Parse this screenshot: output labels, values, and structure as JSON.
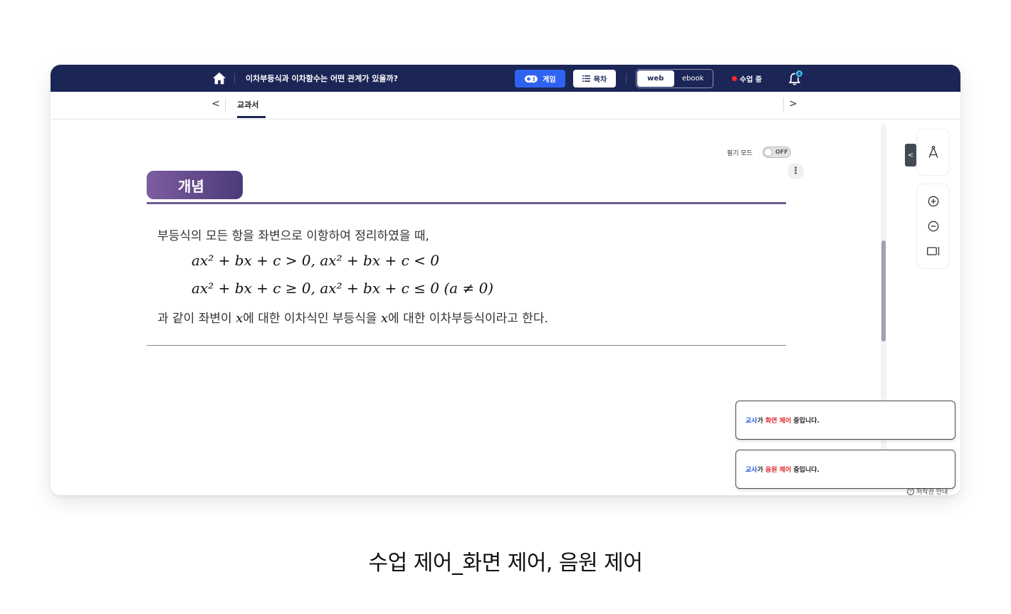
{
  "topbar": {
    "lesson_title": "이차부등식과 이차함수는 어떤 관계가 있을까?",
    "game_label": "게임",
    "toc_label": "목차",
    "view_web": "web",
    "view_ebook": "ebook",
    "live_status": "수업 중",
    "notification_count": "4",
    "colors": {
      "bar": "#1c2656",
      "game": "#2e63f1",
      "live": "#ff2a2a"
    }
  },
  "tabs": {
    "prev": "<",
    "next": ">",
    "items": [
      {
        "label": "교과서",
        "active": true
      }
    ]
  },
  "content": {
    "writing_mode_label": "필기 모드",
    "writing_mode_state": "OFF",
    "more_label": "⋮",
    "concept_badge": "개념",
    "line1": "부등식의 모든 항을 좌변으로 이항하여 정리하였을 때,",
    "math_line2": "ax² + bx + c > 0,    ax² + bx + c < 0",
    "math_line3": "ax² + bx + c ≥ 0,    ax² + bx + c ≤ 0 (a ≠ 0)",
    "line4_part1": "과 같이 좌변이 ",
    "line4_var1": "x",
    "line4_part2": "에 대한 이차식인 부등식을 ",
    "line4_var2": "x",
    "line4_part3": "에 대한 이차부등식이라고 한다."
  },
  "tools": {
    "collapse": "<",
    "icons": [
      "compass-icon",
      "zoom-in-icon",
      "zoom-out-icon",
      "fit-screen-icon"
    ]
  },
  "toasts": [
    {
      "who": "교사",
      "particle1": "가 ",
      "what": "화면 제어",
      "rest": " 중입니다."
    },
    {
      "who": "교사",
      "particle1": "가 ",
      "what": "음원 제어",
      "rest": " 중입니다."
    }
  ],
  "copyright": {
    "icon": "?",
    "label": "저작권 안내"
  },
  "caption": "수업 제어_화면 제어, 음원 제어"
}
